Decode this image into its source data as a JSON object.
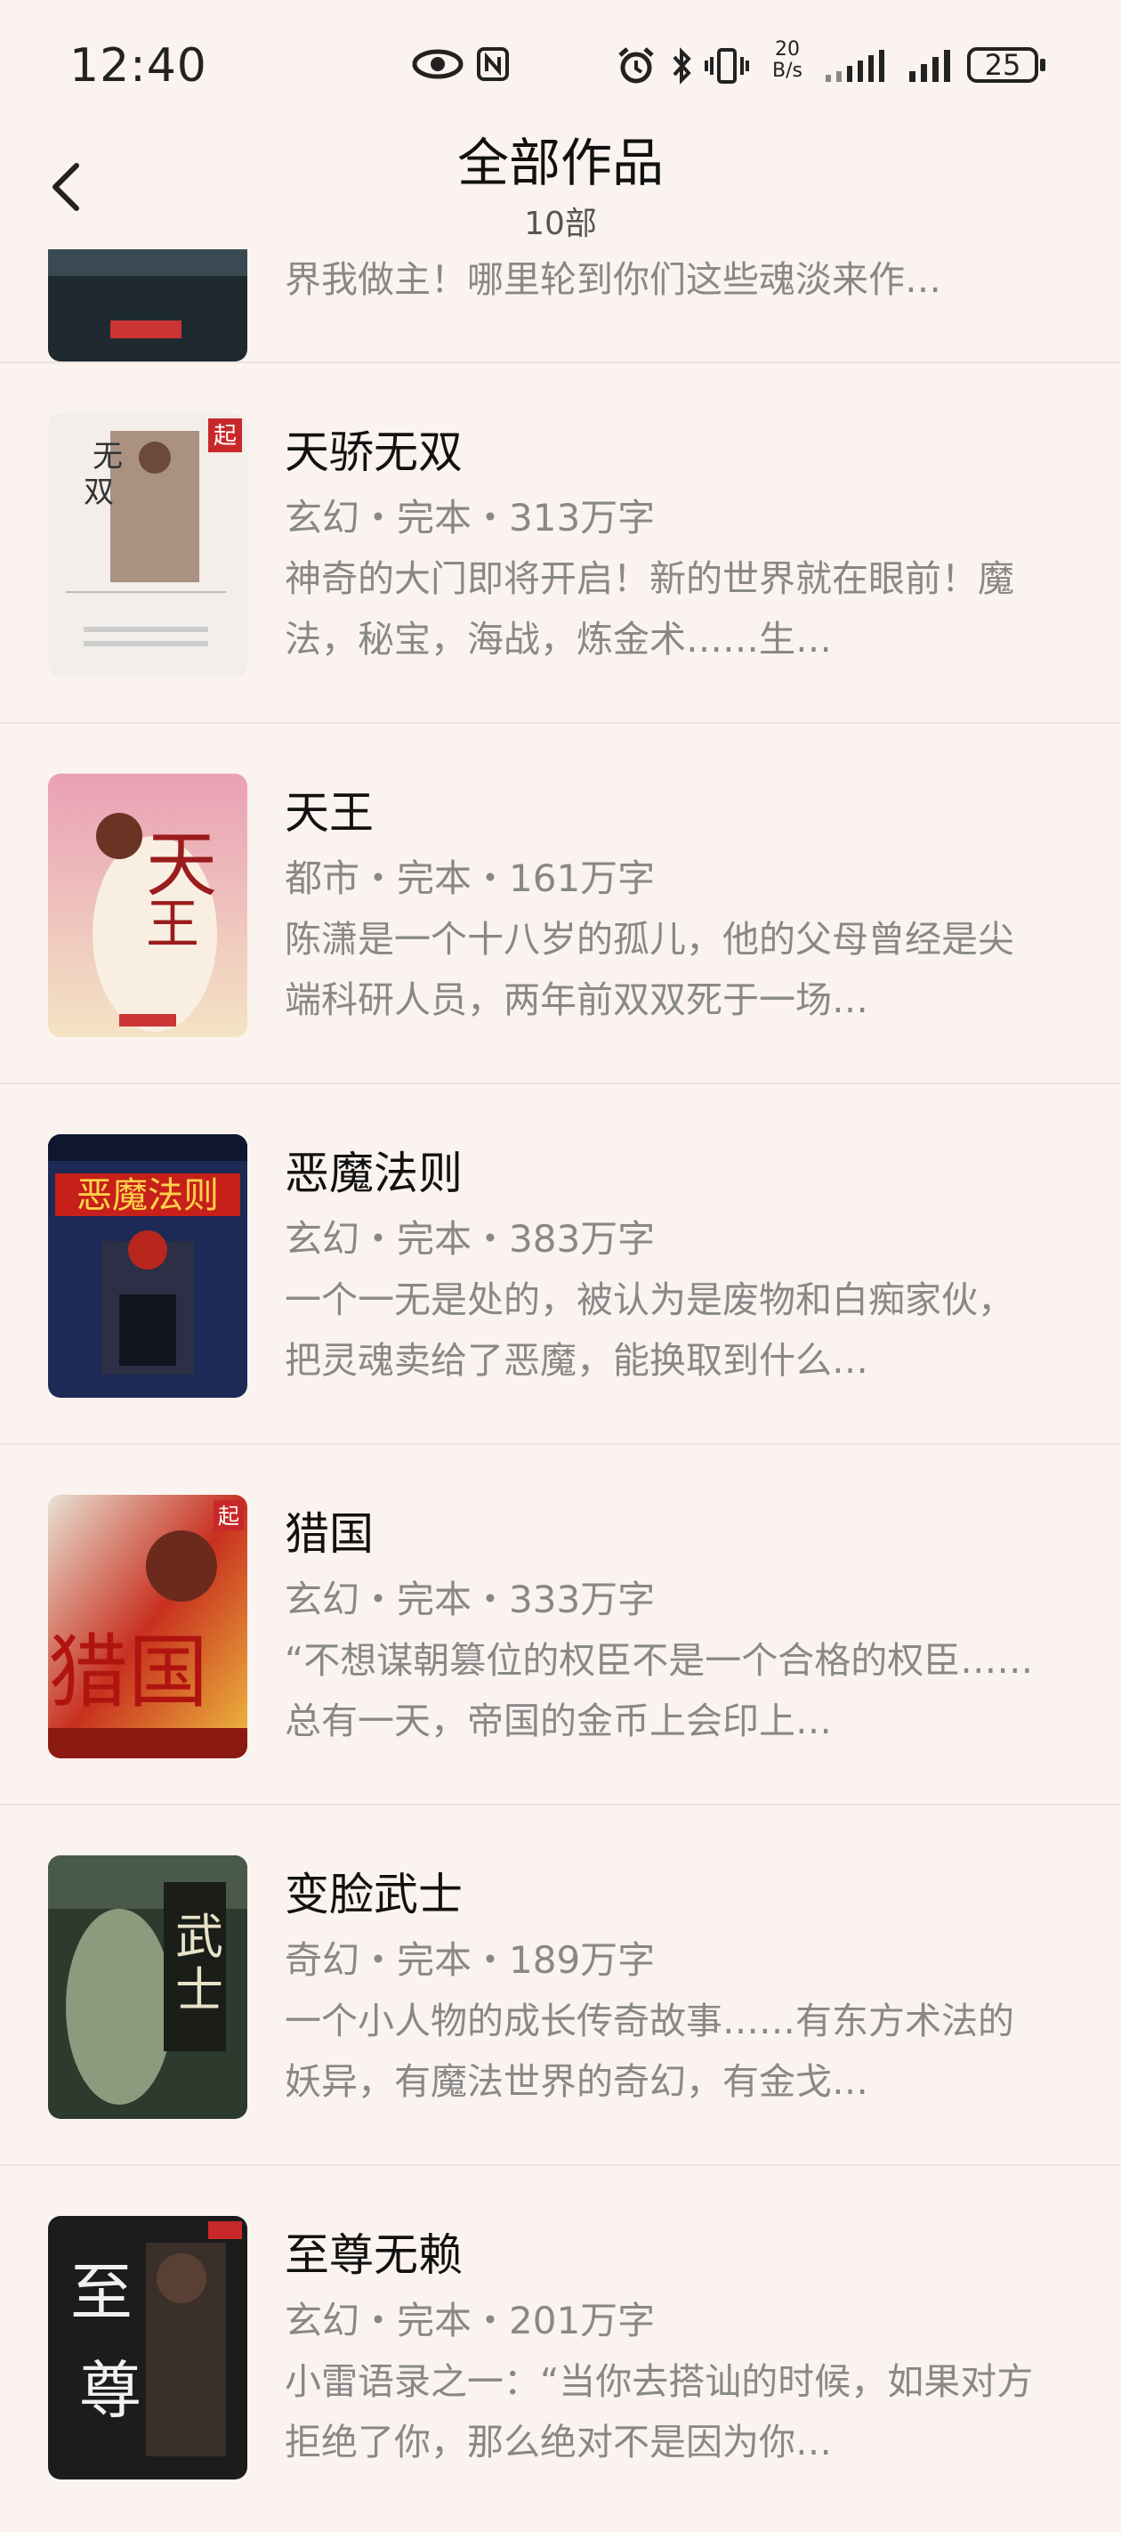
{
  "status": {
    "time": "12:40",
    "net_speed_top": "20",
    "net_speed_bottom": "B/s",
    "battery": "25"
  },
  "header": {
    "title": "全部作品",
    "count": "10部"
  },
  "partial_item": {
    "desc": "界我做主！哪里轮到你们这些魂淡来作…"
  },
  "books": [
    {
      "title": "天骄无双",
      "meta": "玄幻・完本・313万字",
      "desc": "神奇的大门即将开启！新的世界就在眼前！魔法，秘宝，海战，炼金术……生…"
    },
    {
      "title": "天王",
      "meta": "都市・完本・161万字",
      "desc": "陈潇是一个十八岁的孤儿，他的父母曾经是尖端科研人员，两年前双双死于一场…"
    },
    {
      "title": "恶魔法则",
      "meta": "玄幻・完本・383万字",
      "desc": "一个一无是处的，被认为是废物和白痴家伙，把灵魂卖给了恶魔，能换取到什么…"
    },
    {
      "title": "猎国",
      "meta": "玄幻・完本・333万字",
      "desc": "“不想谋朝篡位的权臣不是一个合格的权臣……总有一天，帝国的金币上会印上…"
    },
    {
      "title": "变脸武士",
      "meta": "奇幻・完本・189万字",
      "desc": "一个小人物的成长传奇故事……有东方术法的妖异，有魔法世界的奇幻，有金戈…"
    },
    {
      "title": "至尊无赖",
      "meta": "玄幻・完本・201万字",
      "desc": "小雷语录之一：“当你去搭讪的时候，如果对方拒绝了你，那么绝对不是因为你…"
    }
  ]
}
